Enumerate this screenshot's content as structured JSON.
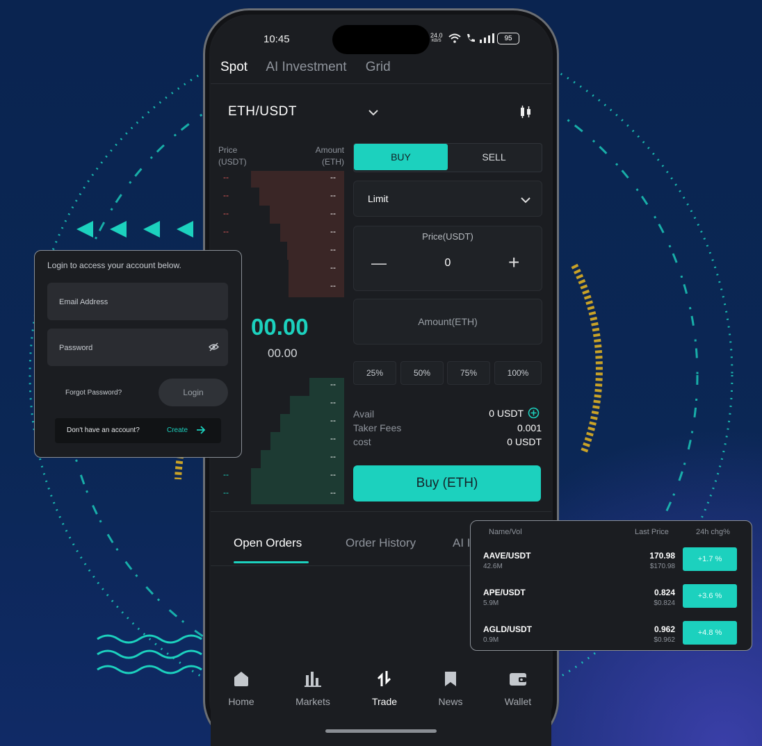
{
  "status_bar": {
    "time": "10:45",
    "net_speed_top": "24.0",
    "net_speed_unit": "KB/S",
    "battery": "95"
  },
  "top_tabs": [
    {
      "label": "Spot",
      "active": true
    },
    {
      "label": "AI Investment",
      "active": false
    },
    {
      "label": "Grid",
      "active": false
    }
  ],
  "pair": {
    "name": "ETH/USDT"
  },
  "orderbook": {
    "price_header": "Price\n(USDT)",
    "amount_header": "Amount\n(ETH)",
    "ask_rows": [
      "--",
      "--",
      "--",
      "--",
      "--",
      "--",
      "--"
    ],
    "bid_rows": [
      "--",
      "--",
      "--",
      "--",
      "--",
      "--",
      "--"
    ],
    "last_price": "00.00",
    "last_price_sub": "00.00",
    "placeholder": "--"
  },
  "order_form": {
    "buy_label": "BUY",
    "sell_label": "SELL",
    "order_type": "Limit",
    "price_label": "Price(USDT)",
    "price_value": "0",
    "minus": "—",
    "plus": "+",
    "amount_placeholder": "Amount(ETH)",
    "percents": [
      "25%",
      "50%",
      "75%",
      "100%"
    ],
    "avail_label": "Avail",
    "avail_value": "0 USDT",
    "fees_label": "Taker Fees",
    "fees_value": "0.001",
    "cost_label": "cost",
    "cost_value": "0 USDT",
    "submit_label": "Buy (ETH)"
  },
  "order_tabs": [
    {
      "label": "Open Orders",
      "active": true
    },
    {
      "label": "Order History",
      "active": false
    },
    {
      "label": "AI I",
      "active": false
    }
  ],
  "bottom_nav": [
    {
      "label": "Home",
      "icon": "home-icon"
    },
    {
      "label": "Markets",
      "icon": "markets-icon"
    },
    {
      "label": "Trade",
      "icon": "trade-icon",
      "active": true
    },
    {
      "label": "News",
      "icon": "news-icon"
    },
    {
      "label": "Wallet",
      "icon": "wallet-icon"
    }
  ],
  "login_card": {
    "title": "Login to access your account below.",
    "email_placeholder": "Email Address",
    "password_placeholder": "Password",
    "forgot": "Forgot Password?",
    "login_button": "Login",
    "no_account": "Don't have an account?",
    "create": "Create"
  },
  "market_card": {
    "headers": {
      "name": "Name/Vol",
      "last": "Last Price",
      "chg": "24h chg%"
    },
    "rows": [
      {
        "pair": "AAVE/USDT",
        "vol": "42.6M",
        "price": "170.98",
        "usd": "$170.98",
        "chg": "+1.7 %"
      },
      {
        "pair": "APE/USDT",
        "vol": "5.9M",
        "price": "0.824",
        "usd": "$0.824",
        "chg": "+3.6 %"
      },
      {
        "pair": "AGLD/USDT",
        "vol": "0.9M",
        "price": "0.962",
        "usd": "$0.962",
        "chg": "+4.8 %"
      }
    ]
  },
  "colors": {
    "accent": "#1cd1be",
    "gold": "#c9a227",
    "bg": "#0a2450",
    "ask": "#e05a5a",
    "panel": "#1b1d21"
  }
}
